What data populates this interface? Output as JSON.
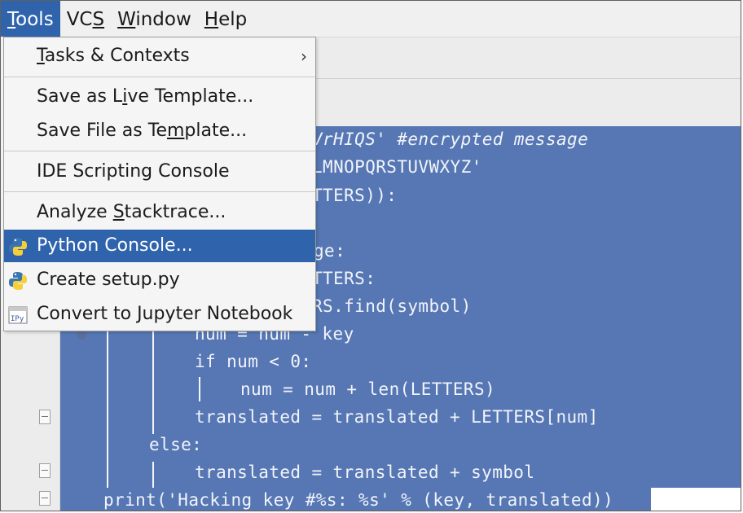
{
  "menubar": {
    "items": [
      {
        "pre": "",
        "ul": "T",
        "post": "ools"
      },
      {
        "pre": "VC",
        "ul": "S",
        "post": ""
      },
      {
        "pre": "",
        "ul": "W",
        "post": "indow"
      },
      {
        "pre": "",
        "ul": "H",
        "post": "elp"
      }
    ]
  },
  "tools_menu": {
    "items": [
      {
        "pre": "",
        "ul": "T",
        "post": "asks & Contexts",
        "submenu_arrow": "›"
      },
      {
        "pre": "Save as L",
        "ul": "i",
        "post": "ve Template..."
      },
      {
        "pre": "Save File as Te",
        "ul": "m",
        "post": "plate..."
      },
      {
        "pre": "IDE Scripting Console",
        "ul": "",
        "post": ""
      },
      {
        "pre": "Analyze ",
        "ul": "S",
        "post": "tacktrace..."
      },
      {
        "pre": "Python Console...",
        "ul": "",
        "post": "",
        "icon": "python-icon",
        "selected": true
      },
      {
        "pre": "Create setup.py",
        "ul": "",
        "post": "",
        "icon": "python-setup-icon"
      },
      {
        "pre": "Convert to Jupyter Notebook",
        "ul": "",
        "post": "",
        "icon": "jupyter-notebook-icon"
      }
    ]
  },
  "editor": {
    "lines": [
      {
        "text": "VrHIQS' #encrypted message"
      },
      {
        "text": "LMNOPQRSTUVWXYZ'"
      },
      {
        "text": "TTERS)):"
      },
      {
        "text": "ge:"
      },
      {
        "text": "TTERS:"
      },
      {
        "text": "RS.find(symbol)"
      },
      {
        "text": "num = num - key"
      },
      {
        "text": "if num < 0:"
      },
      {
        "text": "num = num + len(LETTERS)"
      },
      {
        "text": "translated = translated + LETTERS[num]"
      },
      {
        "text": "else:"
      },
      {
        "text": "translated = translated + symbol"
      },
      {
        "text": "print('Hacking key #%s: %s' % (key, translated))"
      }
    ]
  },
  "colors": {
    "selection": "#2f64ad",
    "editor_selection": "#5677b4"
  }
}
